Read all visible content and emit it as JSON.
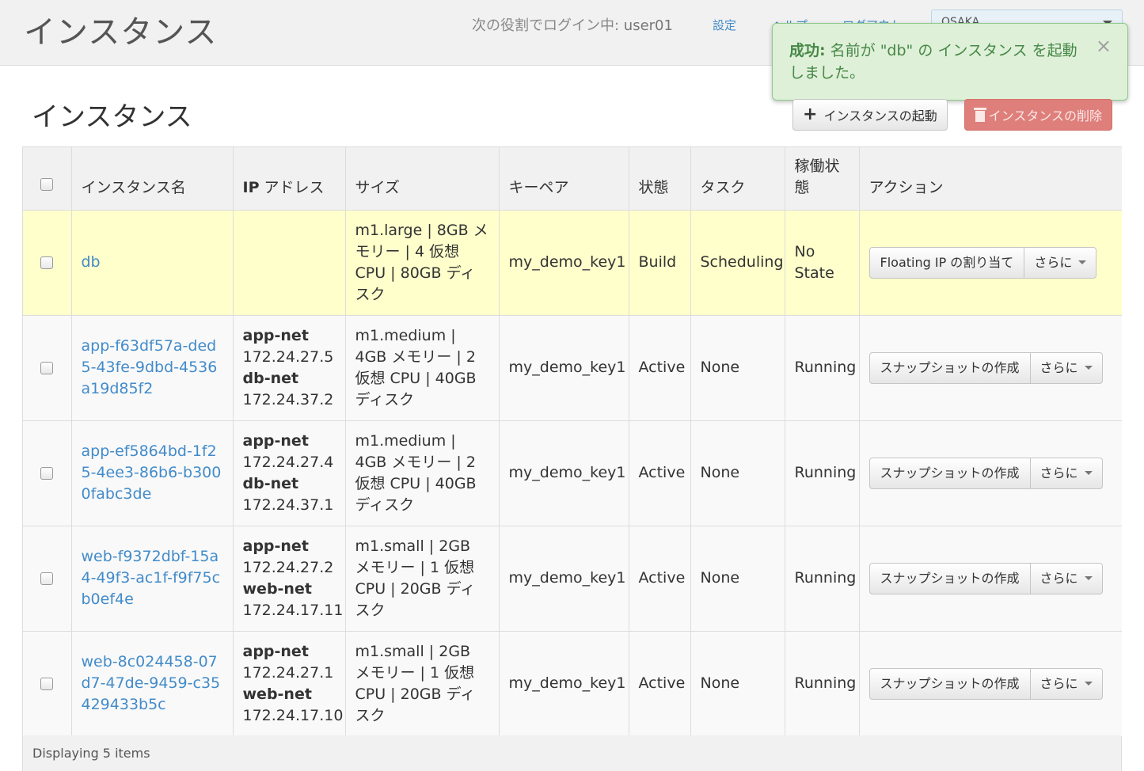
{
  "header": {
    "brand": "インスタンス",
    "login_status_prefix": "次の役割でログイン中: ",
    "user": "user01",
    "settings": "設定",
    "help": "ヘルプ",
    "logout": "ログアウト",
    "region": "OSAKA"
  },
  "alert": {
    "strong": "成功:",
    "message": " 名前が \"db\" の インスタンス を起動しました。",
    "close": "×"
  },
  "page": {
    "title": "インスタンス",
    "launch_button": "インスタンスの起動",
    "delete_button": "インスタンスの削除"
  },
  "table": {
    "headers": {
      "name": "インスタンス名",
      "ip": "IP アドレス",
      "size": "サイズ",
      "keypair": "キーペア",
      "status": "状態",
      "task": "タスク",
      "power": "稼働状態",
      "actions": "アクション"
    },
    "rows": [
      {
        "name": "db",
        "ip": [],
        "size": "m1.large | 8GB メモリー | 4 仮想 CPU | 80GB ディスク",
        "keypair": "my_demo_key1",
        "status": "Build",
        "task": "Scheduling",
        "power": "No State",
        "action": "Floating IP の割り当て",
        "more": "さらに"
      },
      {
        "name": "app-f63df57a-ded5-43fe-9dbd-4536a19d85f2",
        "ip": [
          {
            "net": "app-net",
            "addr": "172.24.27.5"
          },
          {
            "net": "db-net",
            "addr": "172.24.37.2"
          }
        ],
        "size": "m1.medium | 4GB メモリー | 2 仮想 CPU | 40GB ディスク",
        "keypair": "my_demo_key1",
        "status": "Active",
        "task": "None",
        "power": "Running",
        "action": "スナップショットの作成",
        "more": "さらに"
      },
      {
        "name": "app-ef5864bd-1f25-4ee3-86b6-b3000fabc3de",
        "ip": [
          {
            "net": "app-net",
            "addr": "172.24.27.4"
          },
          {
            "net": "db-net",
            "addr": "172.24.37.1"
          }
        ],
        "size": "m1.medium | 4GB メモリー | 2 仮想 CPU | 40GB ディスク",
        "keypair": "my_demo_key1",
        "status": "Active",
        "task": "None",
        "power": "Running",
        "action": "スナップショットの作成",
        "more": "さらに"
      },
      {
        "name": "web-f9372dbf-15a4-49f3-ac1f-f9f75cb0ef4e",
        "ip": [
          {
            "net": "app-net",
            "addr": "172.24.27.2"
          },
          {
            "net": "web-net",
            "addr": "172.24.17.11"
          }
        ],
        "size": "m1.small | 2GB メモリー | 1 仮想 CPU | 20GB ディスク",
        "keypair": "my_demo_key1",
        "status": "Active",
        "task": "None",
        "power": "Running",
        "action": "スナップショットの作成",
        "more": "さらに"
      },
      {
        "name": "web-8c024458-07d7-47de-9459-c35429433b5c",
        "ip": [
          {
            "net": "app-net",
            "addr": "172.24.27.1"
          },
          {
            "net": "web-net",
            "addr": "172.24.17.10"
          }
        ],
        "size": "m1.small | 2GB メモリー | 1 仮想 CPU | 20GB ディスク",
        "keypair": "my_demo_key1",
        "status": "Active",
        "task": "None",
        "power": "Running",
        "action": "スナップショットの作成",
        "more": "さらに"
      }
    ],
    "footer": "Displaying 5 items"
  }
}
